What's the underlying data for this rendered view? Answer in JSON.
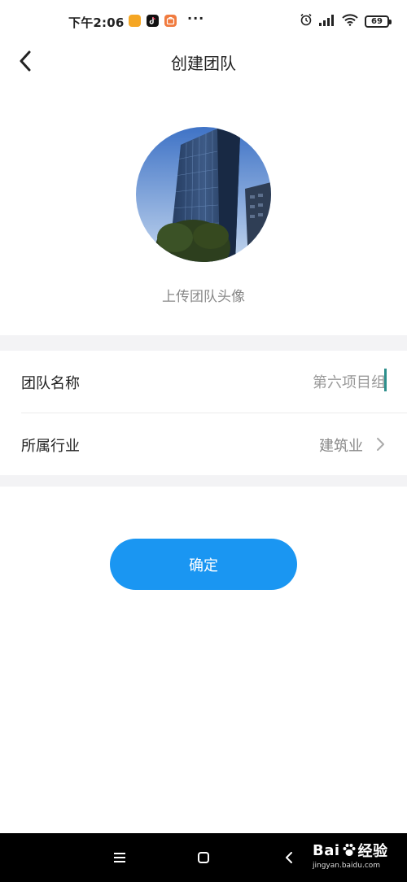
{
  "status_bar": {
    "time": "下午2:06",
    "dots": "···",
    "battery": "69"
  },
  "header": {
    "title": "创建团队"
  },
  "avatar": {
    "upload_label": "上传团队头像"
  },
  "form": {
    "team_name": {
      "label": "团队名称",
      "value": "第六项目组"
    },
    "industry": {
      "label": "所属行业",
      "value": "建筑业"
    }
  },
  "confirm": {
    "label": "确定"
  },
  "watermark": {
    "brand_text": "Bai",
    "brand_suffix": "经验",
    "url": "jingyan.baidu.com"
  },
  "colors": {
    "accent": "#1a96f2",
    "separator": "#f3f3f5",
    "caret": "#2d8f8c"
  }
}
